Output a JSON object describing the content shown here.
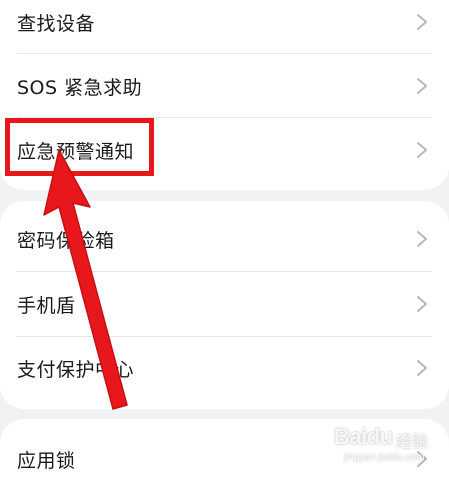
{
  "settings_list": {
    "items": [
      {
        "label": "查找设备",
        "chevron": "chevron-right-icon"
      },
      {
        "label": "SOS 紧急求助",
        "chevron": "chevron-right-icon"
      },
      {
        "label": "应急预警通知",
        "chevron": "chevron-right-icon"
      },
      {
        "label": "密码保险箱",
        "chevron": "chevron-right-icon"
      },
      {
        "label": "手机盾",
        "chevron": "chevron-right-icon"
      },
      {
        "label": "支付保护中心",
        "chevron": "chevron-right-icon"
      },
      {
        "label": "应用锁",
        "chevron": "chevron-right-icon"
      }
    ]
  },
  "annotation": {
    "highlight_color": "#e8171b",
    "highlighted_item": "应急预警通知"
  },
  "watermark": {
    "brand": "Baidu",
    "brand_cn": "经验",
    "url": "jingyan.baidu.com"
  },
  "colors": {
    "background": "#f1f2f4",
    "card": "#ffffff",
    "text": "#1a1a1a",
    "chevron": "#b8b8b8",
    "annotation_red": "#e8171b"
  }
}
